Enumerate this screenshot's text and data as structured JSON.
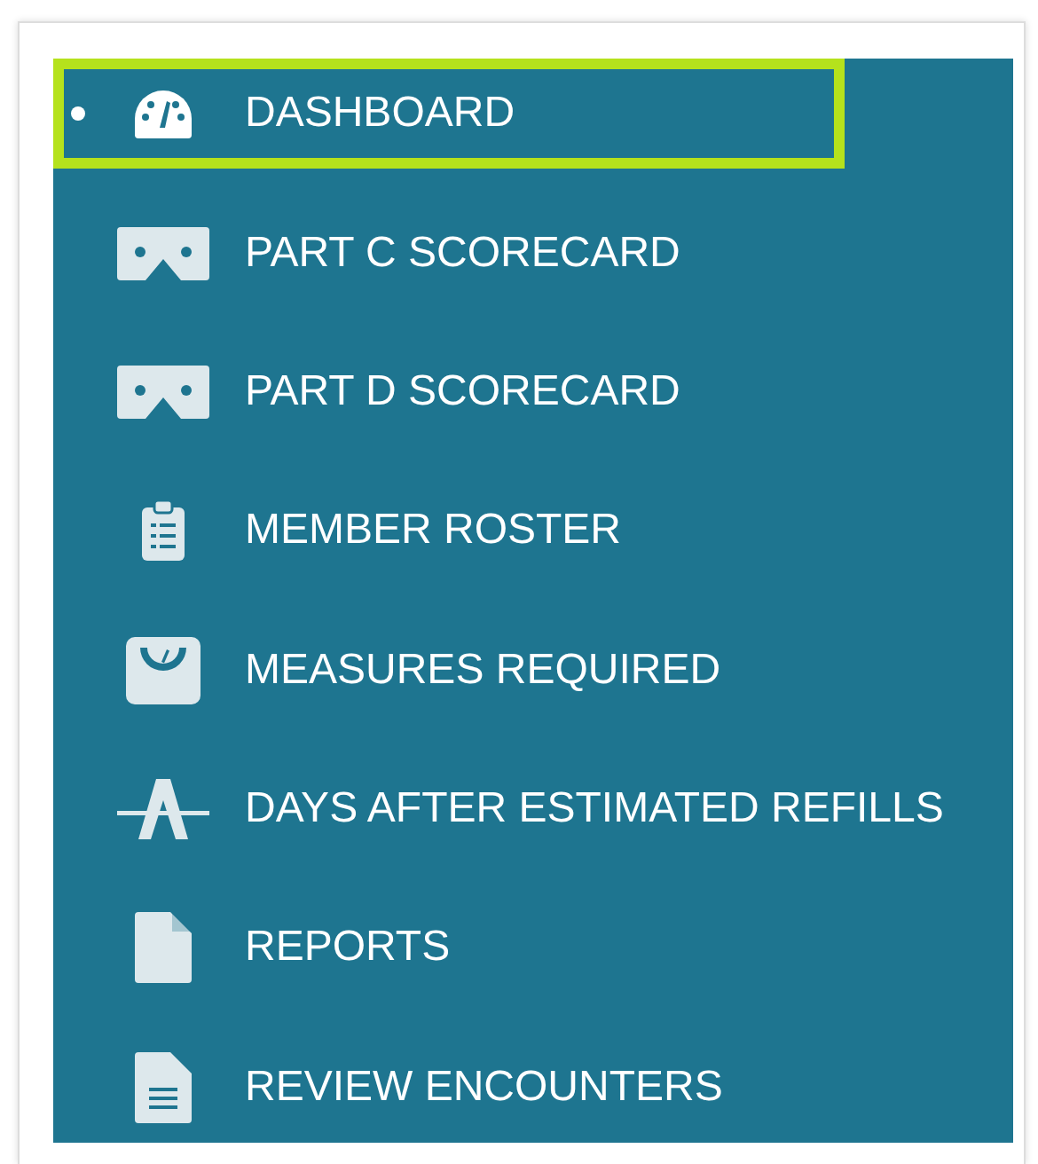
{
  "menu": [
    {
      "label": "DASHBOARD",
      "kind": "gauge",
      "selected": true
    },
    {
      "label": "PART C SCORECARD",
      "kind": "cardboard",
      "selected": false
    },
    {
      "label": "PART D SCORECARD",
      "kind": "cardboard",
      "selected": false
    },
    {
      "label": "MEMBER ROSTER",
      "kind": "clipboard",
      "selected": false
    },
    {
      "label": "MEASURES REQUIRED",
      "kind": "scale",
      "selected": false
    },
    {
      "label": "DAYS AFTER ESTIMATED REFILLS",
      "kind": "road",
      "selected": false
    },
    {
      "label": "REPORTS",
      "kind": "file",
      "selected": false
    },
    {
      "label": "REVIEW ENCOUNTERS",
      "kind": "filelines",
      "selected": false
    }
  ]
}
